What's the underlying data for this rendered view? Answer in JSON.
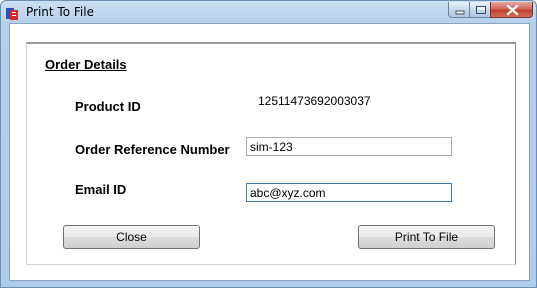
{
  "window": {
    "title": "Print To File",
    "app_icon": "printer-icon",
    "controls": [
      "minimize-icon",
      "maximize-icon",
      "close-icon"
    ]
  },
  "order_details": {
    "section_title": "Order Details",
    "product_id": {
      "label": "Product ID",
      "value": "12511473692003037"
    },
    "order_reference": {
      "label": "Order Reference Number",
      "value": "sim-123"
    },
    "email": {
      "label": "Email ID",
      "value": "abc@xyz.com"
    }
  },
  "buttons": {
    "close_label": "Close",
    "print_label": "Print To File"
  },
  "colors": {
    "title_bar": "#b7d1ec",
    "close_button": "#c9463a",
    "focused_border": "#3d7bad"
  }
}
